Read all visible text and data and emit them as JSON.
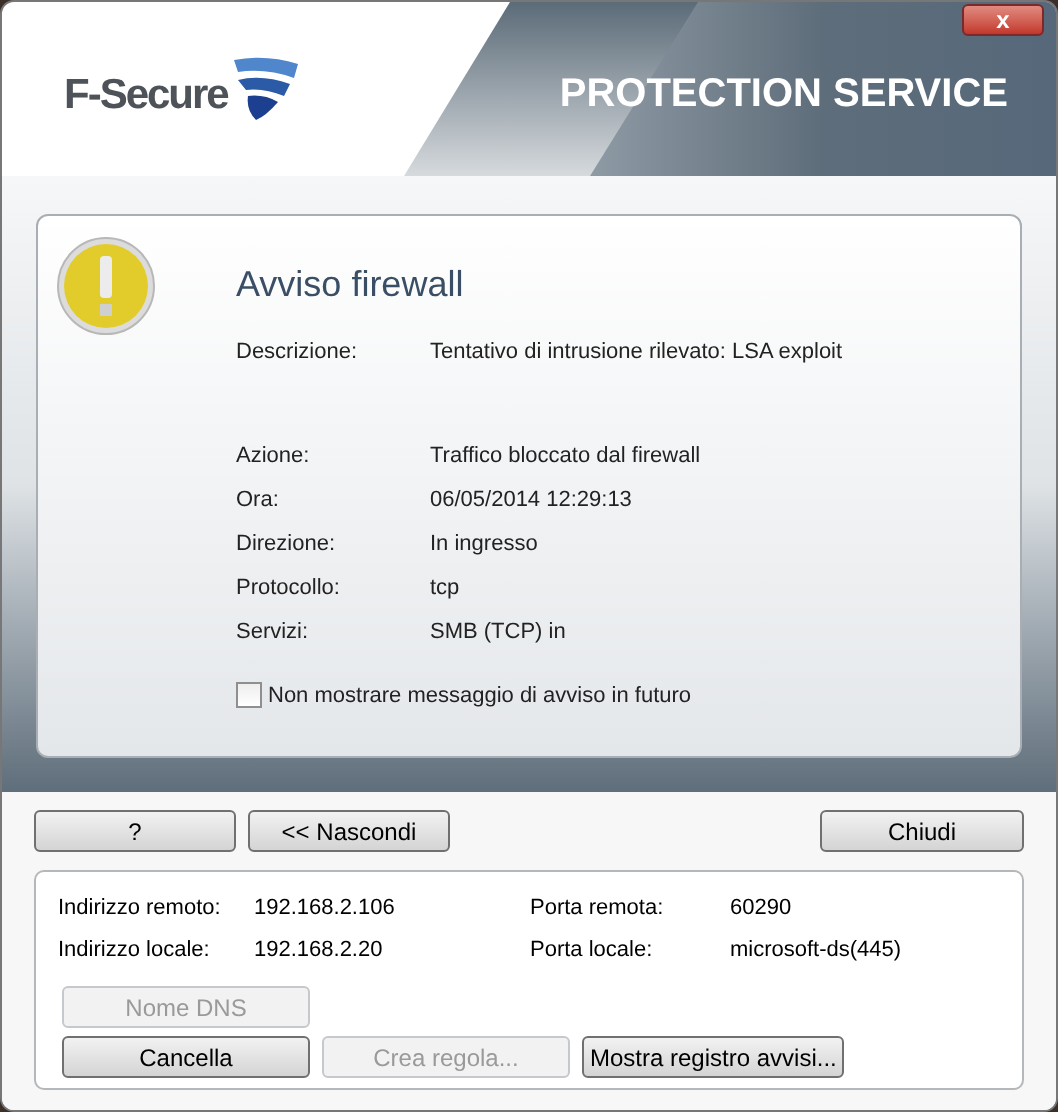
{
  "header": {
    "brand": "F-Secure",
    "product": "PROTECTION SERVICE",
    "close_label": "x"
  },
  "alert": {
    "title": "Avviso firewall",
    "description": {
      "label": "Descrizione:",
      "value": "Tentativo di intrusione rilevato: LSA exploit"
    },
    "details": [
      {
        "label": "Azione:",
        "value": "Traffico bloccato dal firewall"
      },
      {
        "label": "Ora:",
        "value": "06/05/2014 12:29:13"
      },
      {
        "label": "Direzione:",
        "value": "In ingresso"
      },
      {
        "label": "Protocollo:",
        "value": "tcp"
      },
      {
        "label": "Servizi:",
        "value": "SMB (TCP) in"
      }
    ],
    "dont_show": {
      "label": "Non mostrare messaggio di avviso in futuro",
      "checked": false
    }
  },
  "buttons": [
    {
      "label": "?",
      "disabled": false
    },
    {
      "label": "<< Nascondi",
      "disabled": false
    },
    {
      "label": "Chiudi",
      "disabled": false
    }
  ],
  "connection": {
    "fields": [
      {
        "label": "Indirizzo remoto:",
        "value": "192.168.2.106"
      },
      {
        "label": "Porta remota:",
        "value": "60290"
      },
      {
        "label": "Indirizzo locale:",
        "value": "192.168.2.20"
      },
      {
        "label": "Porta locale:",
        "value": "microsoft-ds(445)"
      }
    ],
    "dns_button": {
      "label": "Nome DNS",
      "disabled": true
    },
    "actions": [
      {
        "label": "Cancella",
        "disabled": false
      },
      {
        "label": "Crea regola...",
        "disabled": true
      },
      {
        "label": "Mostra registro avvisi...",
        "disabled": false
      }
    ]
  }
}
